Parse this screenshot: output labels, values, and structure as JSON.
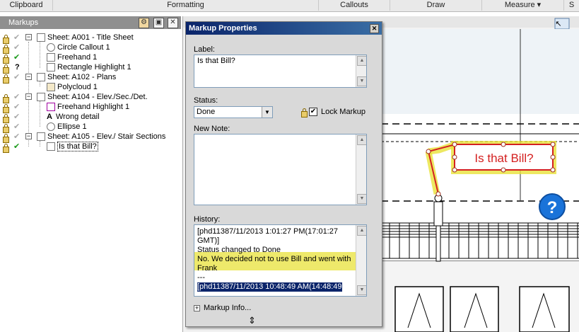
{
  "ribbon": {
    "tabs": [
      "Clipboard",
      "Formatting",
      "Callouts",
      "Draw",
      "Measure ▾",
      "S"
    ]
  },
  "markups_panel": {
    "title": "Markups",
    "tree": [
      {
        "label": "Sheet: A001 - Title Sheet",
        "status": "check_gray",
        "level": 0
      },
      {
        "label": "Circle Callout 1",
        "status": "check_gray",
        "level": 1
      },
      {
        "label": "Freehand 1",
        "status": "check_green",
        "level": 1
      },
      {
        "label": "Rectangle Highlight 1",
        "status": "question",
        "level": 1
      },
      {
        "label": "Sheet: A102 - Plans",
        "status": "check_gray",
        "level": 0
      },
      {
        "label": "Polycloud 1",
        "status": "",
        "level": 1
      },
      {
        "label": "Sheet: A104 - Elev./Sec./Det.",
        "status": "check_gray",
        "level": 0
      },
      {
        "label": "Freehand Highlight 1",
        "status": "check_gray",
        "level": 1
      },
      {
        "label": "Wrong detail",
        "status": "check_gray",
        "level": 1
      },
      {
        "label": "Ellipse 1",
        "status": "check_gray",
        "level": 1
      },
      {
        "label": "Sheet: A105 - Elev./ Stair Sections",
        "status": "check_gray",
        "level": 0
      },
      {
        "label": "Is that Bill?",
        "status": "check_green",
        "level": 1
      }
    ],
    "status_symbols": {
      "check": "✔",
      "question": "?"
    }
  },
  "dialog": {
    "title": "Markup Properties",
    "close": "✕",
    "label_caption": "Label:",
    "label_value": "Is that Bill?",
    "status_caption": "Status:",
    "status_value": "Done",
    "lock_label": "Lock Markup",
    "lock_checked": "✔",
    "new_note_caption": "New Note:",
    "history_caption": "History:",
    "history_lines": [
      "[phd11387/11/2013 1:01:27 PM(17:01:27",
      "GMT)]",
      "Status changed to Done",
      "No. We decided not to use Bill and went with",
      "Frank",
      "---",
      "[phd11387/11/2013 10:48:49 AM(14:48:49"
    ],
    "markup_info": "Markup Info...",
    "expand_symbol": "+"
  },
  "drawing": {
    "callout_text": "Is that Bill?",
    "help_symbol": "?",
    "arrow_symbol": "↖",
    "colors": {
      "callout_red": "#d42020",
      "highlight_yellow": "#e8e23a",
      "help_blue": "#1a73d9"
    }
  }
}
